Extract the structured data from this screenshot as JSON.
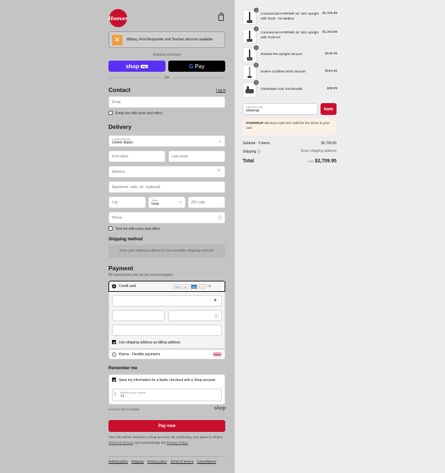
{
  "brand": {
    "logo_text": "Hoover"
  },
  "military": {
    "text": "Military, First Responder and Teacher discount available"
  },
  "express": {
    "label": "Express checkout",
    "shoppay": "shop",
    "shoppay_pill": "Pay",
    "gpay_g": "G",
    "gpay": "Pay",
    "or": "OR"
  },
  "contact": {
    "heading": "Contact",
    "login": "Log in",
    "email_placeholder": "Email",
    "news_label": "Email me with news and offers"
  },
  "delivery": {
    "heading": "Delivery",
    "country_label": "Country/Region",
    "country_value": "United States",
    "first_name": "First name",
    "last_name": "Last name",
    "address": "Address",
    "apartment": "Apartment, suite, etc. (optional)",
    "city": "City",
    "state_label": "State",
    "state_value": "Iowa",
    "zip": "ZIP code",
    "phone": "Phone",
    "text_label": "Text me with news and offers"
  },
  "shipping": {
    "heading": "Shipping method",
    "notice": "Enter your shipping address to view available shipping methods."
  },
  "payment": {
    "heading": "Payment",
    "subtext": "All transactions are secure and encrypted.",
    "credit_card": "Credit card",
    "cards": [
      {
        "name": "VISA",
        "color": "#ffffff",
        "text": "#1a1f71"
      },
      {
        "name": "MC",
        "color": "#ffffff",
        "text": "#eb001b"
      },
      {
        "name": "AMEX",
        "color": "#2e77bc",
        "text": "#ffffff"
      },
      {
        "name": "DISCOVER",
        "color": "#ffffff",
        "text": "#f58220"
      }
    ],
    "more_cards": "+4",
    "billing_label": "Use shipping address as billing address",
    "klarna_label": "Klarna - Flexible payments",
    "klarna_badge": "Klarna"
  },
  "remember": {
    "heading": "Remember me",
    "save_label": "Save my information for a faster checkout with a Shop account",
    "phone_label": "Mobile phone number",
    "phone_value": "+1",
    "secure": "Secure and encrypted",
    "shop": "shop"
  },
  "pay": {
    "button": "Pay now",
    "terms_1": "Your info will be saved to a Shop account. By continuing, you agree to Shop's",
    "terms_link": "Terms of Service",
    "terms_2": "and acknowledge the",
    "privacy_link": "Privacy Policy."
  },
  "footer": [
    "Refund policy",
    "Shipping",
    "Privacy policy",
    "Terms of service",
    "Cancellations"
  ],
  "cart": {
    "items": [
      {
        "qty": "1",
        "name": "Commercial HVRPWR 15\" 40V Upright with Tools - No Battery",
        "price": "$1,049.99"
      },
      {
        "qty": "1",
        "name": "Commercial HVRPWR 15\" 40V Upright with Tools Kit",
        "price": "$1,284.99"
      },
      {
        "qty": "1",
        "name": "Rewind Pet Upright Vacuum",
        "price": "$139.99"
      },
      {
        "qty": "1",
        "name": "Evolve Cordless Stick Vacuum",
        "price": "$194.99"
      },
      {
        "qty": "1",
        "name": "Cleanslate Auto Tool Bundle",
        "price": "$39.99"
      }
    ],
    "discount_label": "Discount code",
    "discount_value": "powerup",
    "apply": "Apply",
    "warn_code": "POWERUP",
    "warn_text": " discount code isn't valid for the items in your cart",
    "subtotal_label": "Subtotal · 5 items",
    "subtotal_value": "$2,709.95",
    "shipping_label": "Shipping",
    "shipping_value": "Enter shipping address",
    "total_label": "Total",
    "currency": "USD",
    "total_value": "$2,709.95"
  },
  "colors": {
    "accent": "#c8102e",
    "shoppay": "#5a31f4"
  }
}
